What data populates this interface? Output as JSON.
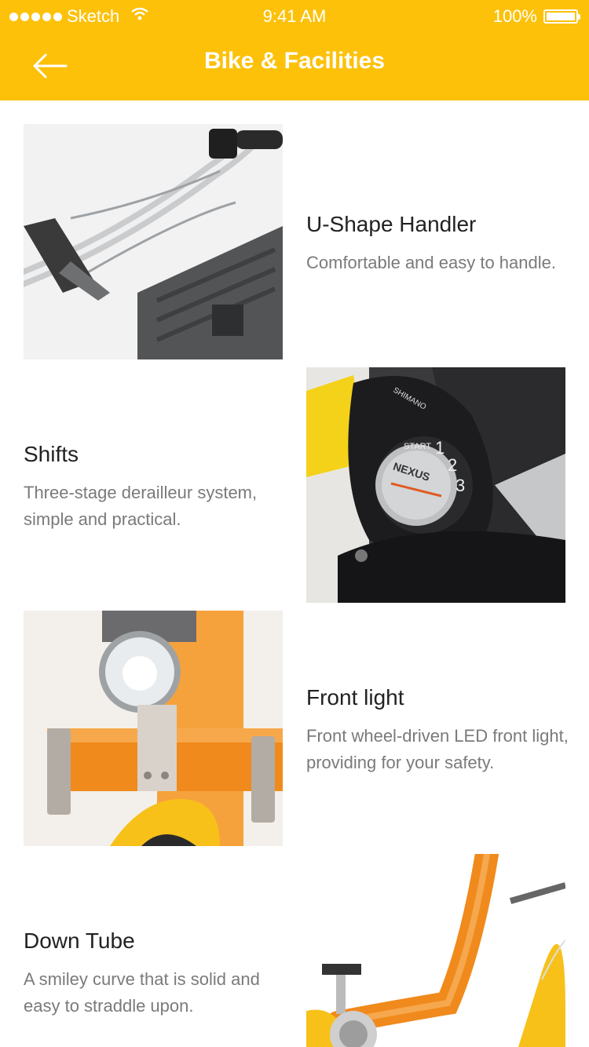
{
  "status_bar": {
    "carrier": "Sketch",
    "time": "9:41 AM",
    "battery": "100%"
  },
  "header": {
    "title": "Bike & Facilities"
  },
  "features": [
    {
      "title": "U-Shape Handler",
      "description": "Comfortable and easy to handle."
    },
    {
      "title": "Shifts",
      "description": "Three-stage derailleur system, simple and practical."
    },
    {
      "title": "Front light",
      "description": "Front wheel-driven LED front light, providing for your safety."
    },
    {
      "title": "Down Tube",
      "description": "A smiley curve that is solid and easy to straddle upon."
    }
  ],
  "shifter_label": {
    "brand": "SHIMANO",
    "model": "NEXUS",
    "start": "START",
    "gears": [
      "1",
      "2",
      "3"
    ]
  },
  "colors": {
    "accent": "#FDC10A",
    "title_text": "#222222",
    "desc_text": "#7a7a7a",
    "bike_orange": "#F08A1C"
  }
}
